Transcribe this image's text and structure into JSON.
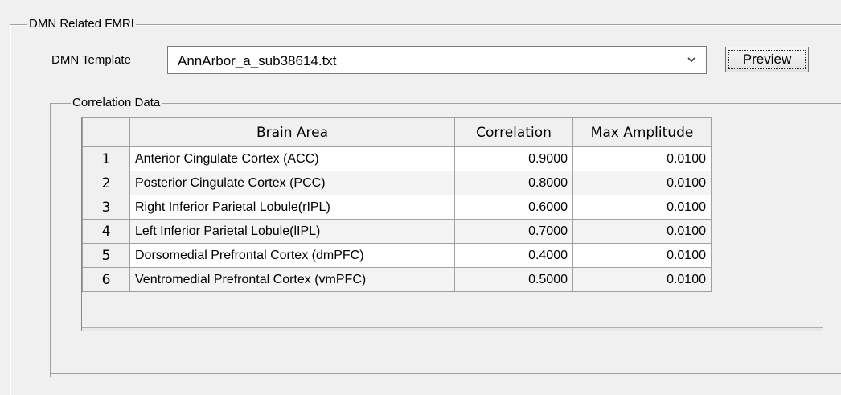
{
  "group": {
    "title": "DMN Related FMRI",
    "template_label": "DMN Template",
    "template_value": "AnnArbor_a_sub38614.txt",
    "preview_label": "Preview"
  },
  "correlation": {
    "title": "Correlation Data",
    "columns": [
      "",
      "Brain Area",
      "Correlation",
      "Max Amplitude"
    ],
    "rows": [
      {
        "num": "1",
        "area": "Anterior Cingulate Cortex (ACC)",
        "correlation": "0.9000",
        "amplitude": "0.0100"
      },
      {
        "num": "2",
        "area": "Posterior Cingulate Cortex (PCC)",
        "correlation": "0.8000",
        "amplitude": "0.0100"
      },
      {
        "num": "3",
        "area": "Right Inferior Parietal Lobule(rIPL)",
        "correlation": "0.6000",
        "amplitude": "0.0100"
      },
      {
        "num": "4",
        "area": "Left Inferior Parietal Lobule(lIPL)",
        "correlation": "0.7000",
        "amplitude": "0.0100"
      },
      {
        "num": "5",
        "area": "Dorsomedial Prefrontal Cortex (dmPFC)",
        "correlation": "0.4000",
        "amplitude": "0.0100"
      },
      {
        "num": "6",
        "area": "Ventromedial Prefrontal Cortex (vmPFC)",
        "correlation": "0.5000",
        "amplitude": "0.0100"
      }
    ]
  },
  "icons": {
    "dropdown": "chevron-down-icon"
  }
}
